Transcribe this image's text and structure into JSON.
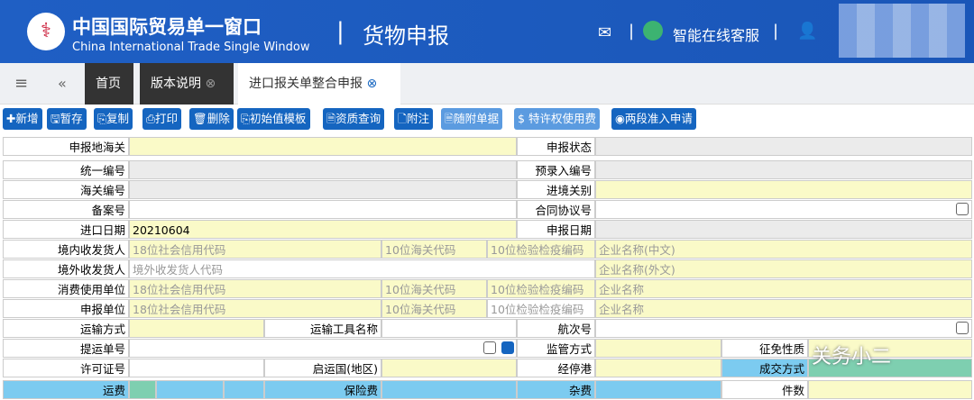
{
  "header": {
    "title_cn": "中国国际贸易单一窗口",
    "title_en": "China International Trade Single Window",
    "separator": "|",
    "module": "货物申报",
    "support": "智能在线客服",
    "sep2": "|"
  },
  "tabs": [
    {
      "label": "首页"
    },
    {
      "label": "版本说明"
    },
    {
      "label": "进口报关单整合申报"
    }
  ],
  "toolbar": [
    "新增",
    "暂存",
    "复制",
    "打印",
    "删除",
    "初始值模板",
    "资质查询",
    "附注",
    "随附单据",
    "特许权使用费",
    "两段准入申请"
  ],
  "form": {
    "r1": [
      "申报地海关",
      "申报状态"
    ],
    "r2": [
      "统一编号",
      "预录入编号"
    ],
    "r3": [
      "海关编号",
      "进境关别"
    ],
    "r4": [
      "备案号",
      "合同协议号"
    ],
    "r5": [
      "进口日期",
      "20210604",
      "申报日期"
    ],
    "r6": [
      "境内收发货人",
      "18位社会信用代码",
      "10位海关代码",
      "10位检验检疫编码",
      "企业名称(中文)"
    ],
    "r7": [
      "境外收发货人",
      "境外收发货人代码",
      "企业名称(外文)"
    ],
    "r8": [
      "消费使用单位",
      "18位社会信用代码",
      "10位海关代码",
      "10位检验检疫编码",
      "企业名称"
    ],
    "r9": [
      "申报单位",
      "18位社会信用代码",
      "10位海关代码",
      "10位检验检疫编码",
      "企业名称"
    ],
    "r10": [
      "运输方式",
      "运输工具名称",
      "航次号"
    ],
    "r11": [
      "提运单号",
      "监管方式",
      "征免性质"
    ],
    "r12": [
      "许可证号",
      "启运国(地区)",
      "经停港",
      "成交方式"
    ],
    "r13": [
      "运费",
      "保险费",
      "杂费",
      "件数"
    ]
  },
  "watermark": "关务小二"
}
